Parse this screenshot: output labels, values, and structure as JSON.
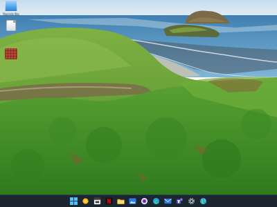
{
  "desktop": {
    "icons": [
      {
        "label": "Recycle Bin",
        "icon": "recycle-bin-icon"
      },
      {
        "label": "",
        "icon": "file-icon"
      },
      {
        "label": "",
        "icon": "app-icon"
      }
    ]
  },
  "taskbar": {
    "background": "#1c2630",
    "items": [
      {
        "name": "start",
        "icon": "windows-start-icon"
      },
      {
        "name": "weather",
        "icon": "weather-icon"
      },
      {
        "name": "calendar",
        "icon": "calendar-icon"
      },
      {
        "name": "netflix",
        "icon": "netflix-icon"
      },
      {
        "name": "file-explorer",
        "icon": "folder-icon"
      },
      {
        "name": "photos",
        "icon": "photos-icon"
      },
      {
        "name": "media",
        "icon": "media-disc-icon"
      },
      {
        "name": "edge",
        "icon": "edge-browser-icon"
      },
      {
        "name": "mail",
        "icon": "mail-icon"
      },
      {
        "name": "teams",
        "icon": "teams-icon"
      },
      {
        "name": "settings",
        "icon": "gear-icon"
      },
      {
        "name": "globe",
        "icon": "globe-icon"
      }
    ]
  },
  "colors": {
    "sky": "#cfe3f2",
    "sea": "#5d98c4",
    "grass": "#4f9a2c",
    "accent": "#2f7fd6"
  }
}
